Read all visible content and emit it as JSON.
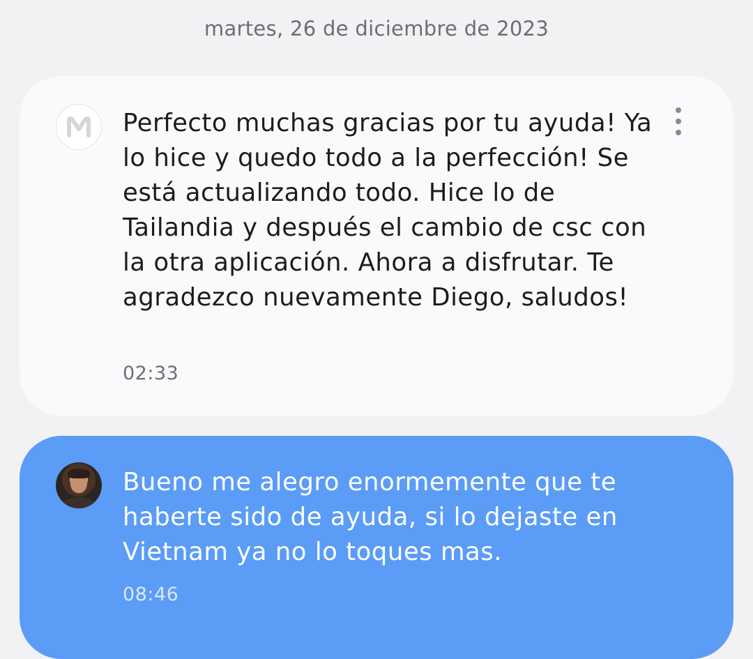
{
  "date_separator": "martes, 26 de diciembre de 2023",
  "messages": [
    {
      "direction": "incoming",
      "avatar_icon": "m-letter-icon",
      "text": "Perfecto muchas gracias por tu ayuda! Ya lo hice y quedo todo a la perfección! Se está actualizando todo. Hice lo de Tailandia y después el cambio de csc con la otra aplicación. Ahora a disfrutar. Te agradezco nuevamente Diego, saludos!",
      "time": "02:33",
      "menu_icon": "more-vertical-icon"
    },
    {
      "direction": "outgoing",
      "avatar_icon": "profile-photo",
      "text": "Bueno me alegro enormemente que te haberte sido de ayuda, si lo dejaste en Vietnam ya no lo toques mas.",
      "time": "08:46"
    }
  ],
  "colors": {
    "background": "#f2f2f4",
    "incoming_bubble": "#fafafc",
    "outgoing_bubble": "#5b9cf7",
    "text_dark": "#1c1c1e",
    "text_muted": "#6e6e72"
  }
}
